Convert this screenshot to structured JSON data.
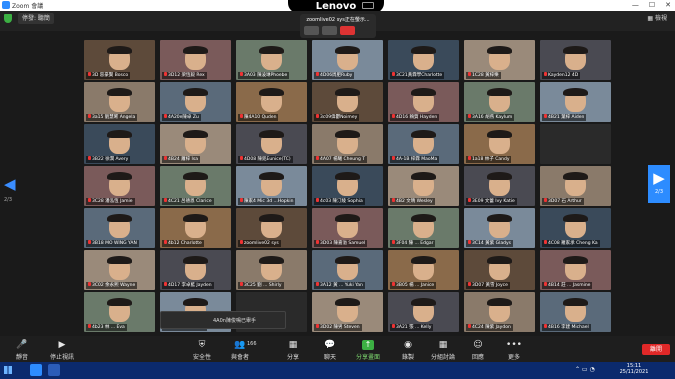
{
  "window": {
    "title": "Zoom 會議"
  },
  "device_brand": "Lenovo",
  "meeting": {
    "speaker_label": "停發: 聽簡",
    "share_banner": "zoomlive02 sys正在螢示...",
    "view_label": "檢視"
  },
  "grid": {
    "page_left": "2/3",
    "page_right": "2/3",
    "tiles": [
      {
        "name": "3D 容豪賢 Bosco"
      },
      {
        "name": "3D12 梁恆毅 Rex"
      },
      {
        "name": "3A03 陳凌琳Phoebe"
      },
      {
        "name": "4D06周肥Ruby"
      },
      {
        "name": "3C21黃霖學Charlotte"
      },
      {
        "name": "1C28 黃梓樂"
      },
      {
        "name": "Kayden12 4D"
      },
      {
        "name": "3a15 劉慧晞 Angela"
      },
      {
        "name": "4A20e陳卓 Zu"
      },
      {
        "name": "陳4A10 Quden"
      },
      {
        "name": "3c09偉鬱Noimey"
      },
      {
        "name": "4D16 賴賀 Hayden"
      },
      {
        "name": "3A16 胡燕 Kaylum"
      },
      {
        "name": "4B21 葉梓 Aiden"
      },
      {
        "name": "3B22 徐潤 Avery"
      },
      {
        "name": "4B24 蕭梓 Isa"
      },
      {
        "name": "4D08 陳銘Eunice(TC)"
      },
      {
        "name": "4A07 楊曦 Cheung T"
      },
      {
        "name": "4A-1B 梓霖 MaoMa"
      },
      {
        "name": "1a18 林子 Candy"
      },
      {
        "name": ""
      },
      {
        "name": "3C28 潘泓恆 Jamie"
      },
      {
        "name": "4C21 呂德恩 Clarice"
      },
      {
        "name": "陳家4 Mic 3d ...Hopkin"
      },
      {
        "name": "4c03 陳汀綾 Sophia"
      },
      {
        "name": "4B2 文晴 Wesley"
      },
      {
        "name": "3E09 文蕾 Ivy Katie"
      },
      {
        "name": "3D07 石 Arthur"
      },
      {
        "name": "3B18 MO WING YAN"
      },
      {
        "name": "4b12 Charlotte"
      },
      {
        "name": "zoomlive02 sys"
      },
      {
        "name": "3D03 陳嘉溢 Samuel"
      },
      {
        "name": "3F04 陳 ... Edgar"
      },
      {
        "name": "3C14 黃紫 Gladys"
      },
      {
        "name": "4C08 羅家承 Cheng Ka"
      },
      {
        "name": "3C02 余永熙 Wayne"
      },
      {
        "name": "4D17 李卓藍 Jayden"
      },
      {
        "name": "3C25 劉 ... Shirly"
      },
      {
        "name": "3A12 黃 ... Yuki Yan"
      },
      {
        "name": "3B05 楊 ... Janice"
      },
      {
        "name": "3D07 黃雪 Joyce"
      },
      {
        "name": "4B14 莊 ... Jasmine"
      },
      {
        "name": "4b23 林 ... Eva"
      },
      {
        "name": "4b32 王 ... Chloe"
      },
      {
        "name": ""
      },
      {
        "name": "3D02 陳男 Steven"
      },
      {
        "name": "3A21 張 ... Kelly"
      },
      {
        "name": "4C24 陳紫 Jaydon"
      },
      {
        "name": "4B16 李建 Michael"
      }
    ]
  },
  "popup": {
    "text": "4A0n陳俊鳴已舉手"
  },
  "toolbar": {
    "items": [
      {
        "label": "靜音",
        "icon": "microphone-icon"
      },
      {
        "label": "停止視訊",
        "icon": "video-icon"
      },
      {
        "label": "安全性",
        "icon": "shield-icon"
      },
      {
        "label": "與會者",
        "icon": "participants-icon",
        "count": "166"
      },
      {
        "label": "分享",
        "icon": "share-icon"
      },
      {
        "label": "聊天",
        "icon": "chat-icon"
      },
      {
        "label": "分享畫面",
        "icon": "share-screen-icon"
      },
      {
        "label": "錄製",
        "icon": "record-icon"
      },
      {
        "label": "分組討論",
        "icon": "breakout-icon"
      },
      {
        "label": "回應",
        "icon": "reaction-icon"
      },
      {
        "label": "更多",
        "icon": "more-icon"
      }
    ],
    "end_label": "離開"
  },
  "taskbar": {
    "time": "15:11",
    "date": "25/11/2021"
  },
  "colors": {
    "accent": "#2d8cff",
    "end": "#e02828",
    "share_green": "#3cb043",
    "taskbar": "#0b2a6d"
  }
}
